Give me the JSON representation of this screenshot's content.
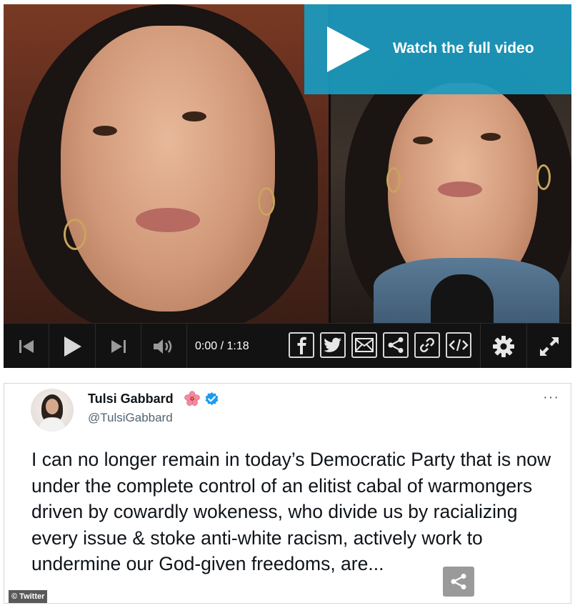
{
  "video": {
    "watch_label": "Watch the full video",
    "time_display": "0:00 / 1:18",
    "overlay_color": "#1b9abe",
    "controls": [
      "skip-back-icon",
      "play-icon",
      "skip-forward-icon",
      "volume-icon",
      "facebook-icon",
      "twitter-icon",
      "email-icon",
      "share-icon",
      "link-icon",
      "embed-icon",
      "gear-icon",
      "fullscreen-icon"
    ]
  },
  "tweet": {
    "name": "Tulsi Gabbard",
    "handle": "@TulsiGabbard",
    "body": "I can no longer remain in today’s Democratic Party that is now under the complete control of an elitist cabal of warmongers driven by cowardly wokeness, who divide us by racializing every issue & stoke anti-white racism, actively work to undermine our God-given freedoms, are...",
    "more": "···",
    "credit": "© Twitter",
    "verified_color": "#1d9bf0"
  }
}
